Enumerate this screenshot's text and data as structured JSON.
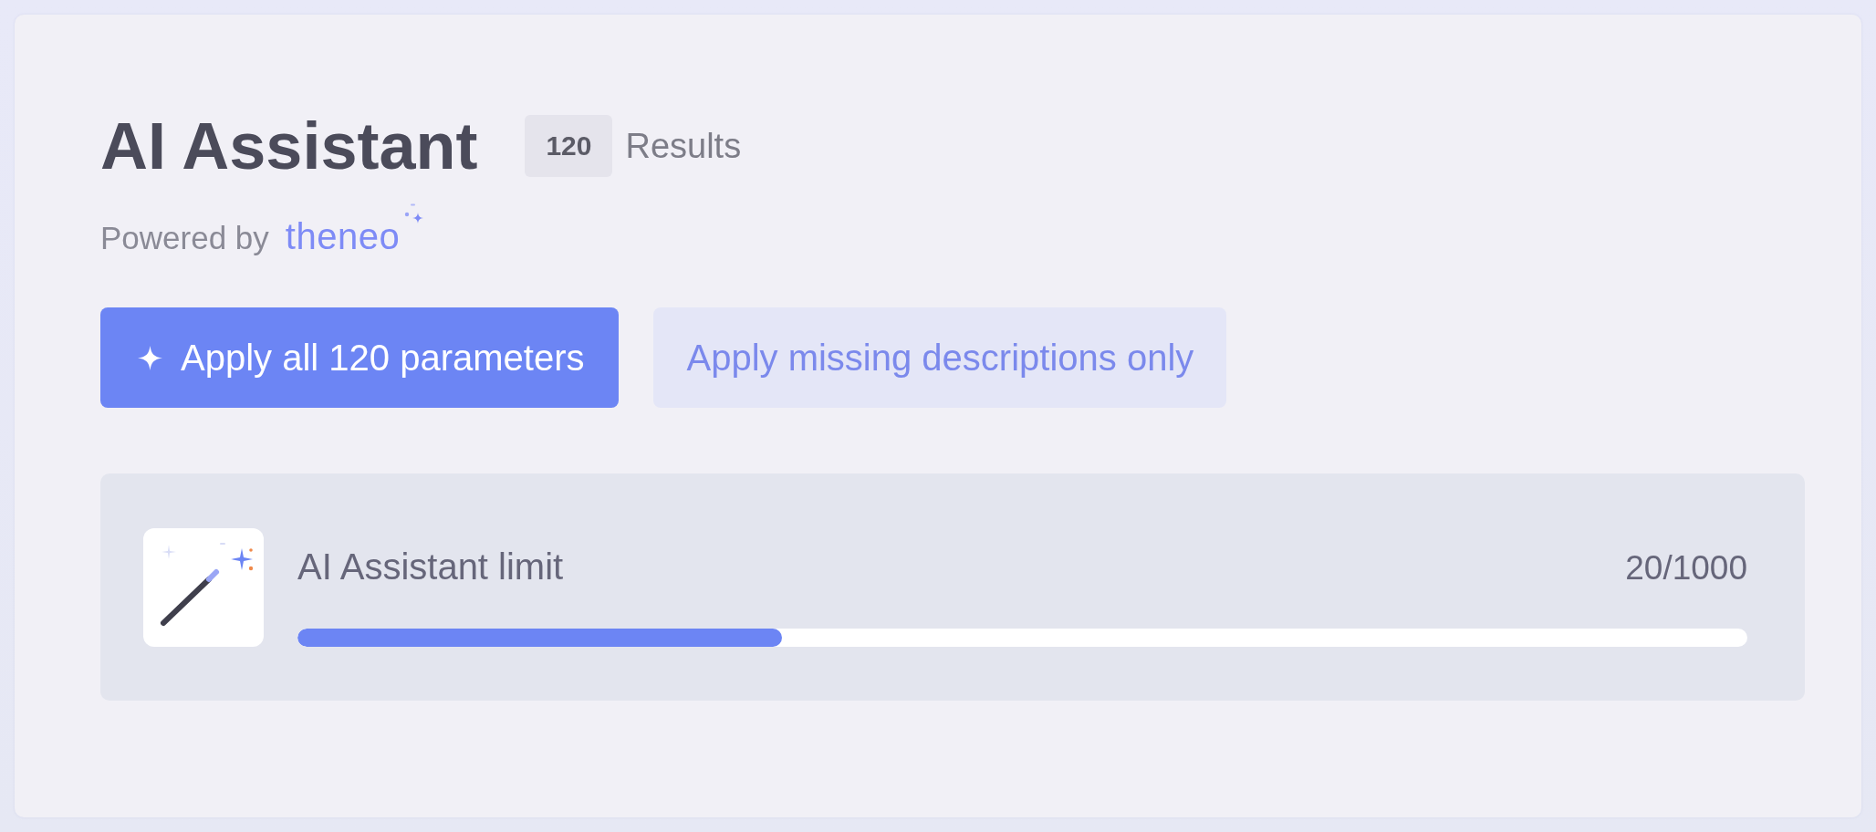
{
  "header": {
    "title": "AI Assistant",
    "result_count": "120",
    "result_label": "Results"
  },
  "powered_by": {
    "label": "Powered by",
    "brand": "theneo"
  },
  "actions": [
    {
      "kind": "primary",
      "label": "Apply all 120 parameters"
    },
    {
      "kind": "secondary",
      "label": "Apply missing descriptions only"
    }
  ],
  "usage": {
    "label": "AI Assistant limit",
    "reading": "20/1000",
    "level": 0.334
  }
}
